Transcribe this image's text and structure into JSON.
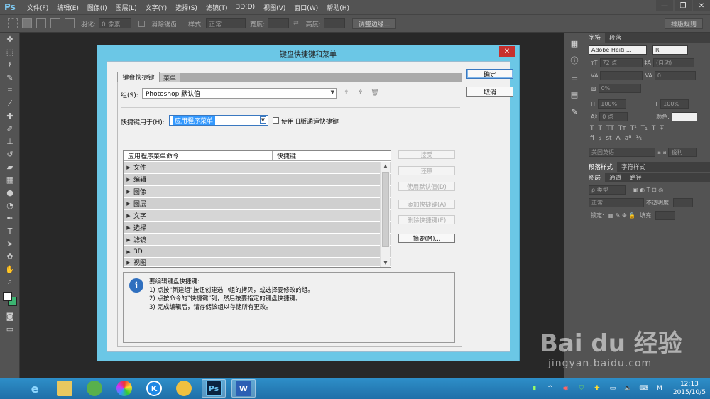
{
  "menubar": {
    "logo": "Ps",
    "items": [
      "文件(F)",
      "编辑(E)",
      "图像(I)",
      "图层(L)",
      "文字(Y)",
      "选择(S)",
      "滤镜(T)",
      "3D(D)",
      "视图(V)",
      "窗口(W)",
      "帮助(H)"
    ],
    "window_controls": [
      "—",
      "❐",
      "✕"
    ]
  },
  "options": {
    "feather_label": "羽化:",
    "feather_value": "0 像素",
    "antialias_label": "消除锯齿",
    "style_label": "样式:",
    "style_value": "正常",
    "width_label": "宽度:",
    "height_label": "高度:",
    "refine_edge": "调整边缘...",
    "workspace": "排版规则"
  },
  "right_panel": {
    "tabs": [
      "字符",
      "段落"
    ],
    "font_family": "Adobe Heiti ...",
    "font_style": "R",
    "font_size": "72 点",
    "leading": "(自动)",
    "kerning": "0",
    "tracking_pct": "0%",
    "vscale": "100%",
    "hscale": "100%",
    "baseline": "0 点",
    "color_label": "颜色:",
    "language": "美国英语",
    "aa_label": "a a",
    "antialias": "锐利",
    "para_tabs": [
      "段落样式",
      "字符样式"
    ],
    "layer_tabs": [
      "图层",
      "通道",
      "路径"
    ],
    "kind": "ρ 类型",
    "blend": "正常",
    "opacity_label": "不透明度:",
    "lock_label": "锁定:",
    "fill_label": "填充:"
  },
  "dialog": {
    "title": "键盘快捷键和菜单",
    "close": "✕",
    "tabs": [
      "键盘快捷键",
      "菜单"
    ],
    "group_label": "组(S):",
    "group_value": "Photoshop 默认值",
    "shortcuts_for_label": "快捷键用于(H):",
    "shortcuts_for_value": "应用程序菜单",
    "legacy_label": "使用旧版通道快捷键",
    "col_command": "应用程序菜单命令",
    "col_shortcut": "快捷键",
    "rows": [
      "文件",
      "编辑",
      "图像",
      "图层",
      "文字",
      "选择",
      "滤镜",
      "3D",
      "视图"
    ],
    "side_buttons": [
      "接受",
      "还原",
      "使用默认值(D)",
      "添加快捷键(A)",
      "删除快捷键(E)",
      "摘要(M)..."
    ],
    "ok": "确定",
    "cancel": "取消",
    "info_lines": [
      "要编辑键盘快捷键:",
      "1) 点按\"新建组\"按钮创建选中组的拷贝，或选择要修改的组。",
      "2) 点按命令的\"快捷键\"列，然后按要指定的键盘快捷键。",
      "3) 完成编辑后，请存储该组以存储所有更改。"
    ]
  },
  "taskbar": {
    "time": "12:13",
    "date": "2015/10/5",
    "ime": "M"
  },
  "watermark": {
    "main": "Bai du 经验",
    "sub": "jingyan.baidu.com"
  }
}
